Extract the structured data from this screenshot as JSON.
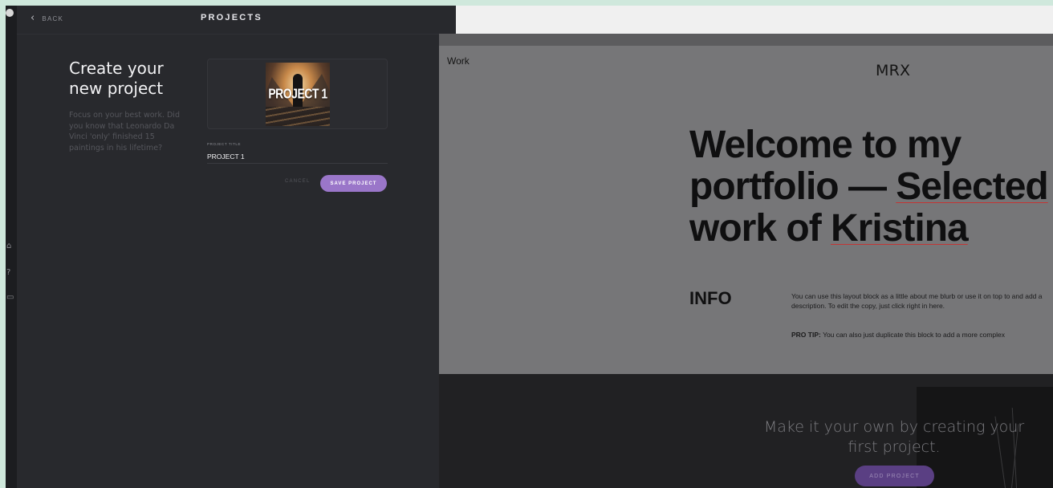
{
  "panel": {
    "back_label": "BACK",
    "title": "PROJECTS",
    "heading": "Create your new project",
    "subtext": "Focus on your best work. Did you know that Leonardo Da Vinci 'only' finished 15 paintings in his lifetime?",
    "thumbnail_text": "PROJECT 1",
    "field_label": "PROJECT TITLE",
    "field_value": "PROJECT 1",
    "cancel_label": "CANCEL",
    "save_label": "SAVE PROJECT"
  },
  "preview": {
    "nav_link": "Work",
    "brand": "MRX",
    "hero_line1": "Welcome to my",
    "hero_line2a": "portfolio — ",
    "hero_line2b": "Selected",
    "hero_line3a": "work of ",
    "hero_line3b": "Kristina",
    "info_title": "INFO",
    "info_body": "You can use this layout block as a little about me blurb or use it on top to and add a description. To edit the copy, just click right in here.",
    "pro_tip_label": "PRO TIP:",
    "pro_tip_text": "You can also just duplicate this block to add a more complex",
    "cta_text": "Make it your own by creating your first project.",
    "add_project_label": "ADD PROJECT"
  },
  "icons": [
    "avatar-icon",
    "chevron-left-icon",
    "gift-icon",
    "help-icon",
    "document-icon"
  ],
  "colors": {
    "accent": "#9a76c9",
    "accent_dim": "#5a3f83",
    "panel_bg": "#28292d",
    "preview_bg": "#767678"
  }
}
